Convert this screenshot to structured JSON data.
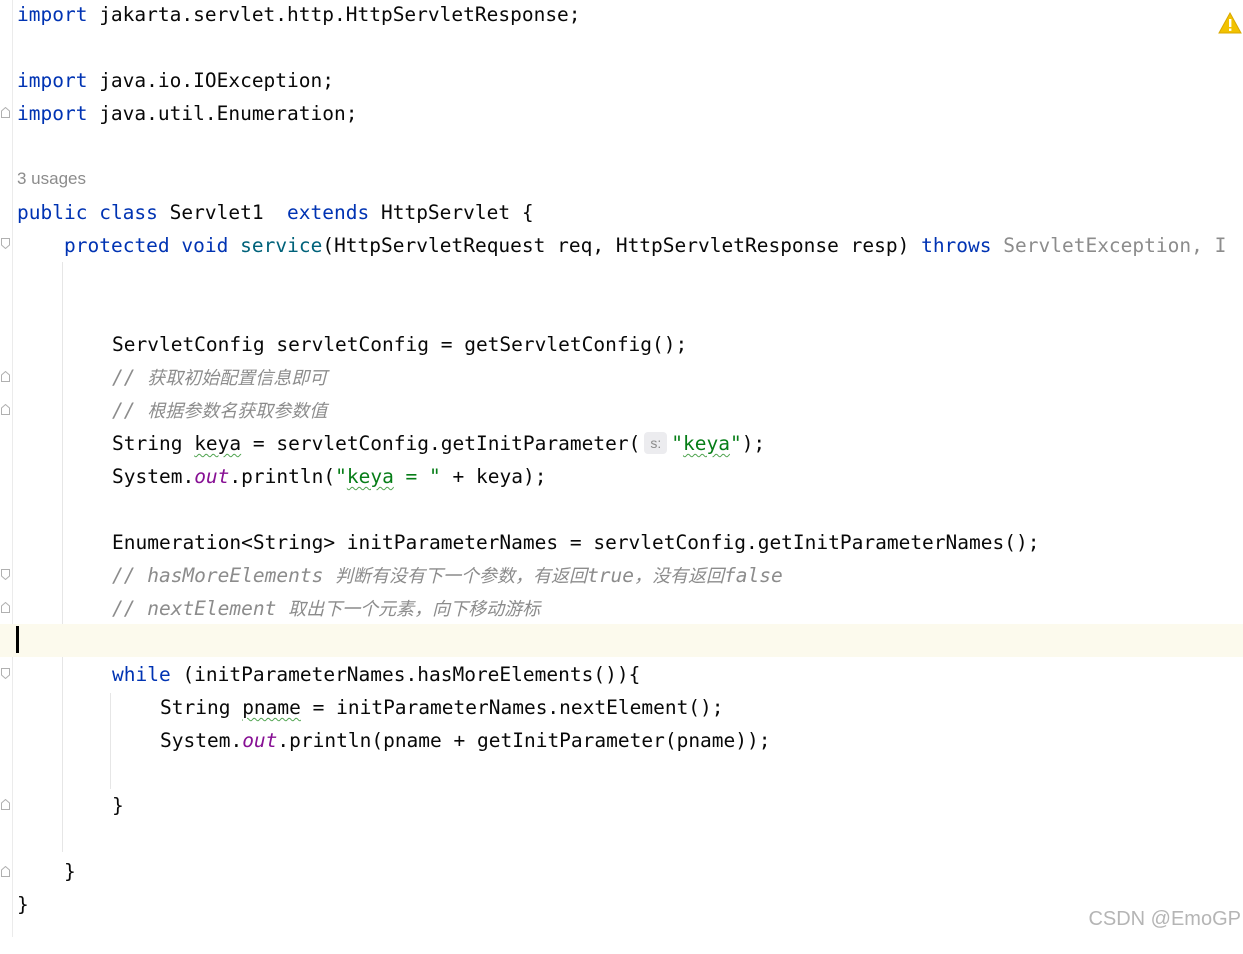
{
  "editor": {
    "usages_hint": "3 usages",
    "param_hint": "s:",
    "watermark": "CSDN @EmoGP",
    "warning_icon": "warning-triangle-icon",
    "lines": {
      "l1": {
        "kw": "import",
        "rest": " jakarta.servlet.http.HttpServletResponse;"
      },
      "l3": {
        "kw": "import",
        "rest": " java.io.IOException;"
      },
      "l4": {
        "kw": "import",
        "rest": " java.util.Enumeration;"
      },
      "l6": {
        "kw1": "public",
        "kw2": "class",
        "name": " Servlet1  ",
        "kw3": "extends",
        "rest": " HttpServlet {"
      },
      "l7": {
        "kw1": "protected",
        "kw2": "void",
        "fn": "service",
        "params": "(HttpServletRequest req, HttpServletResponse resp) ",
        "kw3": "throws",
        "exc": " ServletException, I"
      },
      "l10": {
        "text": "ServletConfig servletConfig = getServletConfig();"
      },
      "l11": {
        "prefix": "// ",
        "cjk": "获取初始配置信息即可"
      },
      "l12": {
        "prefix": "// ",
        "cjk": "根据参数名获取参数值"
      },
      "l13": {
        "a": "String ",
        "var": "keya",
        "b": " = servletConfig.getInitParameter(",
        "str": "\"keya\"",
        "c": ");"
      },
      "l14": {
        "a": "System.",
        "field": "out",
        "b": ".println(",
        "str": "\"keya = \"",
        "c": " + keya);"
      },
      "l16": {
        "text": "Enumeration<String> initParameterNames = servletConfig.getInitParameterNames();"
      },
      "l17": {
        "p1": "// hasMoreElements ",
        "c1": "判断有没有下一个参数，有返回",
        "p2": "true",
        "c2": "，没有返回",
        "p3": "false"
      },
      "l18": {
        "p1": "// nextElement ",
        "c1": "取出下一个元素，向下移动游标"
      },
      "l20": {
        "kw": "while",
        "rest": " (initParameterNames.hasMoreElements()){"
      },
      "l21": {
        "a": "String ",
        "var": "pname",
        "b": " = initParameterNames.nextElement();"
      },
      "l22": {
        "a": "System.",
        "field": "out",
        "b": ".println(pname + getInitParameter(pname));"
      },
      "l24": {
        "text": "}"
      },
      "l26": {
        "text": "}"
      },
      "l27": {
        "text": "}"
      }
    }
  }
}
